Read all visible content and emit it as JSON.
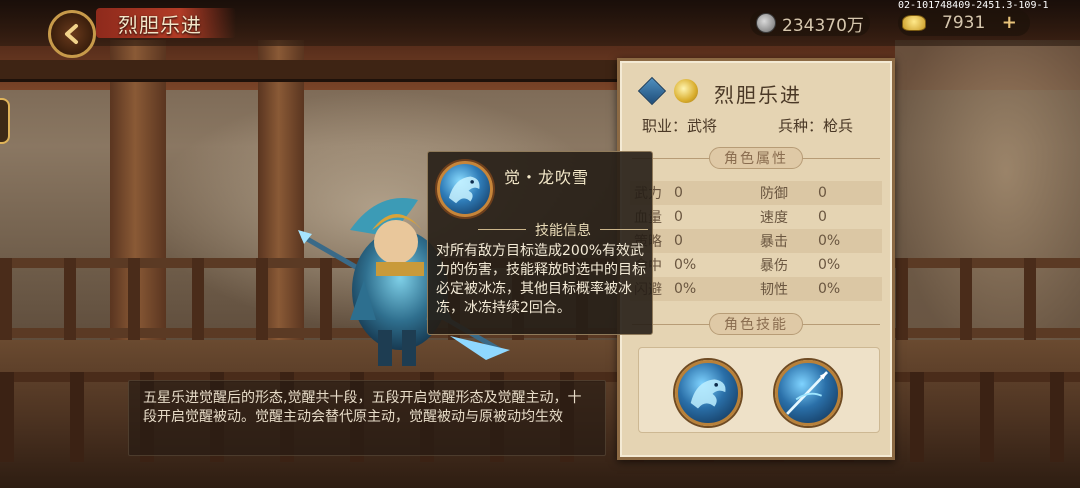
{
  "header": {
    "title": "烈胆乐进",
    "silver_value": "234370万",
    "gold_value": "7931",
    "plus_label": "+",
    "server_id": "02-101748409-2451.3-109-1"
  },
  "tooltip": {
    "skill_name": "觉・龙吹雪",
    "section_label": "技能信息",
    "description": "对所有敌方目标造成200%有效武力的伤害，技能释放时选中的目标必定被冰冻，其他目标概率被冰冻，冰冻持续2回合。"
  },
  "description": "五星乐进觉醒后的形态,觉醒共十段，五段开启觉醒形态及觉醒主动，十段开启觉醒被动。觉醒主动会替代原主动，觉醒被动与原被动均生效",
  "panel": {
    "hero_name": "烈胆乐进",
    "profession_label": "职业：武将",
    "troop_label": "兵种：枪兵",
    "attributes_title": "角色属性",
    "skills_title": "角色技能",
    "attributes": [
      {
        "label1": "武力",
        "value1": "0",
        "label2": "防御",
        "value2": "0"
      },
      {
        "label1": "血量",
        "value1": "0",
        "label2": "速度",
        "value2": "0"
      },
      {
        "label1": "策略",
        "value1": "0",
        "label2": "暴击",
        "value2": "0%"
      },
      {
        "label1": "命中",
        "value1": "0%",
        "label2": "暴伤",
        "value2": "0%"
      },
      {
        "label1": "闪避",
        "value1": "0%",
        "label2": "韧性",
        "value2": "0%"
      }
    ]
  },
  "colors": {
    "panel_bg": "#e5d4b3",
    "panel_border": "#8c6a44",
    "title_red": "#b23c26",
    "tooltip_bg": "#261e16",
    "ice_blue": "#2f7cb8"
  }
}
